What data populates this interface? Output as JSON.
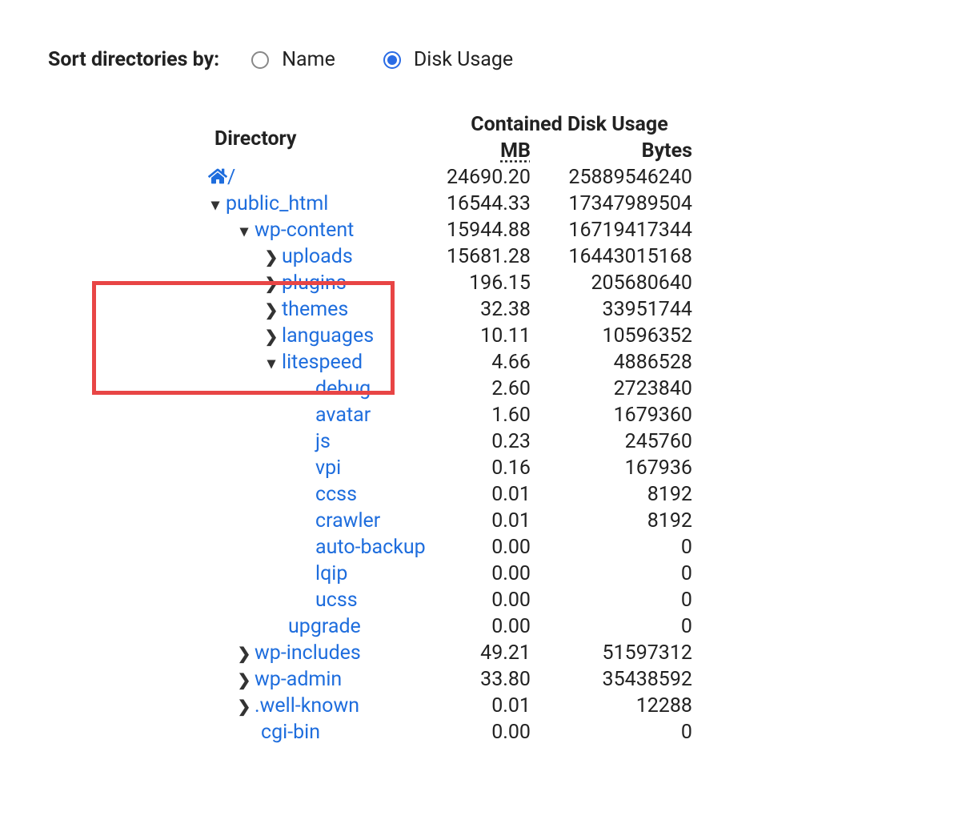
{
  "sort": {
    "label": "Sort directories by:",
    "options": {
      "name": "Name",
      "disk_usage": "Disk Usage"
    },
    "selected": "disk_usage"
  },
  "headers": {
    "directory": "Directory",
    "contained": "Contained Disk Usage",
    "mb": "MB",
    "bytes": "Bytes"
  },
  "rows": [
    {
      "indent": 0,
      "expand": "none",
      "home": true,
      "name": "/",
      "mb": "24690.20",
      "bytes": "25889546240"
    },
    {
      "indent": 1,
      "expand": "open",
      "name": "public_html",
      "mb": "16544.33",
      "bytes": "17347989504"
    },
    {
      "indent": 2,
      "expand": "open",
      "name": "wp-content",
      "mb": "15944.88",
      "bytes": "16719417344"
    },
    {
      "indent": 3,
      "expand": "closed",
      "name": "uploads",
      "mb": "15681.28",
      "bytes": "16443015168"
    },
    {
      "indent": 3,
      "expand": "closed",
      "name": "plugins",
      "mb": "196.15",
      "bytes": "205680640"
    },
    {
      "indent": 3,
      "expand": "closed",
      "name": "themes",
      "mb": "32.38",
      "bytes": "33951744"
    },
    {
      "indent": 3,
      "expand": "closed",
      "name": "languages",
      "mb": "10.11",
      "bytes": "10596352"
    },
    {
      "indent": 4,
      "expand": "open",
      "name": "litespeed",
      "mb": "4.66",
      "bytes": "4886528"
    },
    {
      "indent": 5,
      "expand": "leaf",
      "name": "debug",
      "mb": "2.60",
      "bytes": "2723840"
    },
    {
      "indent": 5,
      "expand": "leaf",
      "name": "avatar",
      "mb": "1.60",
      "bytes": "1679360"
    },
    {
      "indent": 5,
      "expand": "leaf",
      "name": "js",
      "mb": "0.23",
      "bytes": "245760"
    },
    {
      "indent": 5,
      "expand": "leaf",
      "name": "vpi",
      "mb": "0.16",
      "bytes": "167936"
    },
    {
      "indent": 5,
      "expand": "leaf",
      "name": "ccss",
      "mb": "0.01",
      "bytes": "8192"
    },
    {
      "indent": 5,
      "expand": "leaf",
      "name": "crawler",
      "mb": "0.01",
      "bytes": "8192"
    },
    {
      "indent": 5,
      "expand": "leaf",
      "name": "auto-backup",
      "mb": "0.00",
      "bytes": "0"
    },
    {
      "indent": 5,
      "expand": "leaf",
      "name": "lqip",
      "mb": "0.00",
      "bytes": "0"
    },
    {
      "indent": 5,
      "expand": "leaf",
      "name": "ucss",
      "mb": "0.00",
      "bytes": "0"
    },
    {
      "indent": 3,
      "expand": "leaf3",
      "name": "upgrade",
      "mb": "0.00",
      "bytes": "0"
    },
    {
      "indent": 2,
      "expand": "closed",
      "name": "wp-includes",
      "mb": "49.21",
      "bytes": "51597312"
    },
    {
      "indent": 2,
      "expand": "closed",
      "name": "wp-admin",
      "mb": "33.80",
      "bytes": "35438592"
    },
    {
      "indent": 2,
      "expand": "closed",
      "name": ".well-known",
      "mb": "0.01",
      "bytes": "12288"
    },
    {
      "indent": 2,
      "expand": "leaf2",
      "name": "cgi-bin",
      "mb": "0.00",
      "bytes": "0"
    }
  ],
  "highlight": {
    "startRow": 7,
    "endRow": 10
  }
}
